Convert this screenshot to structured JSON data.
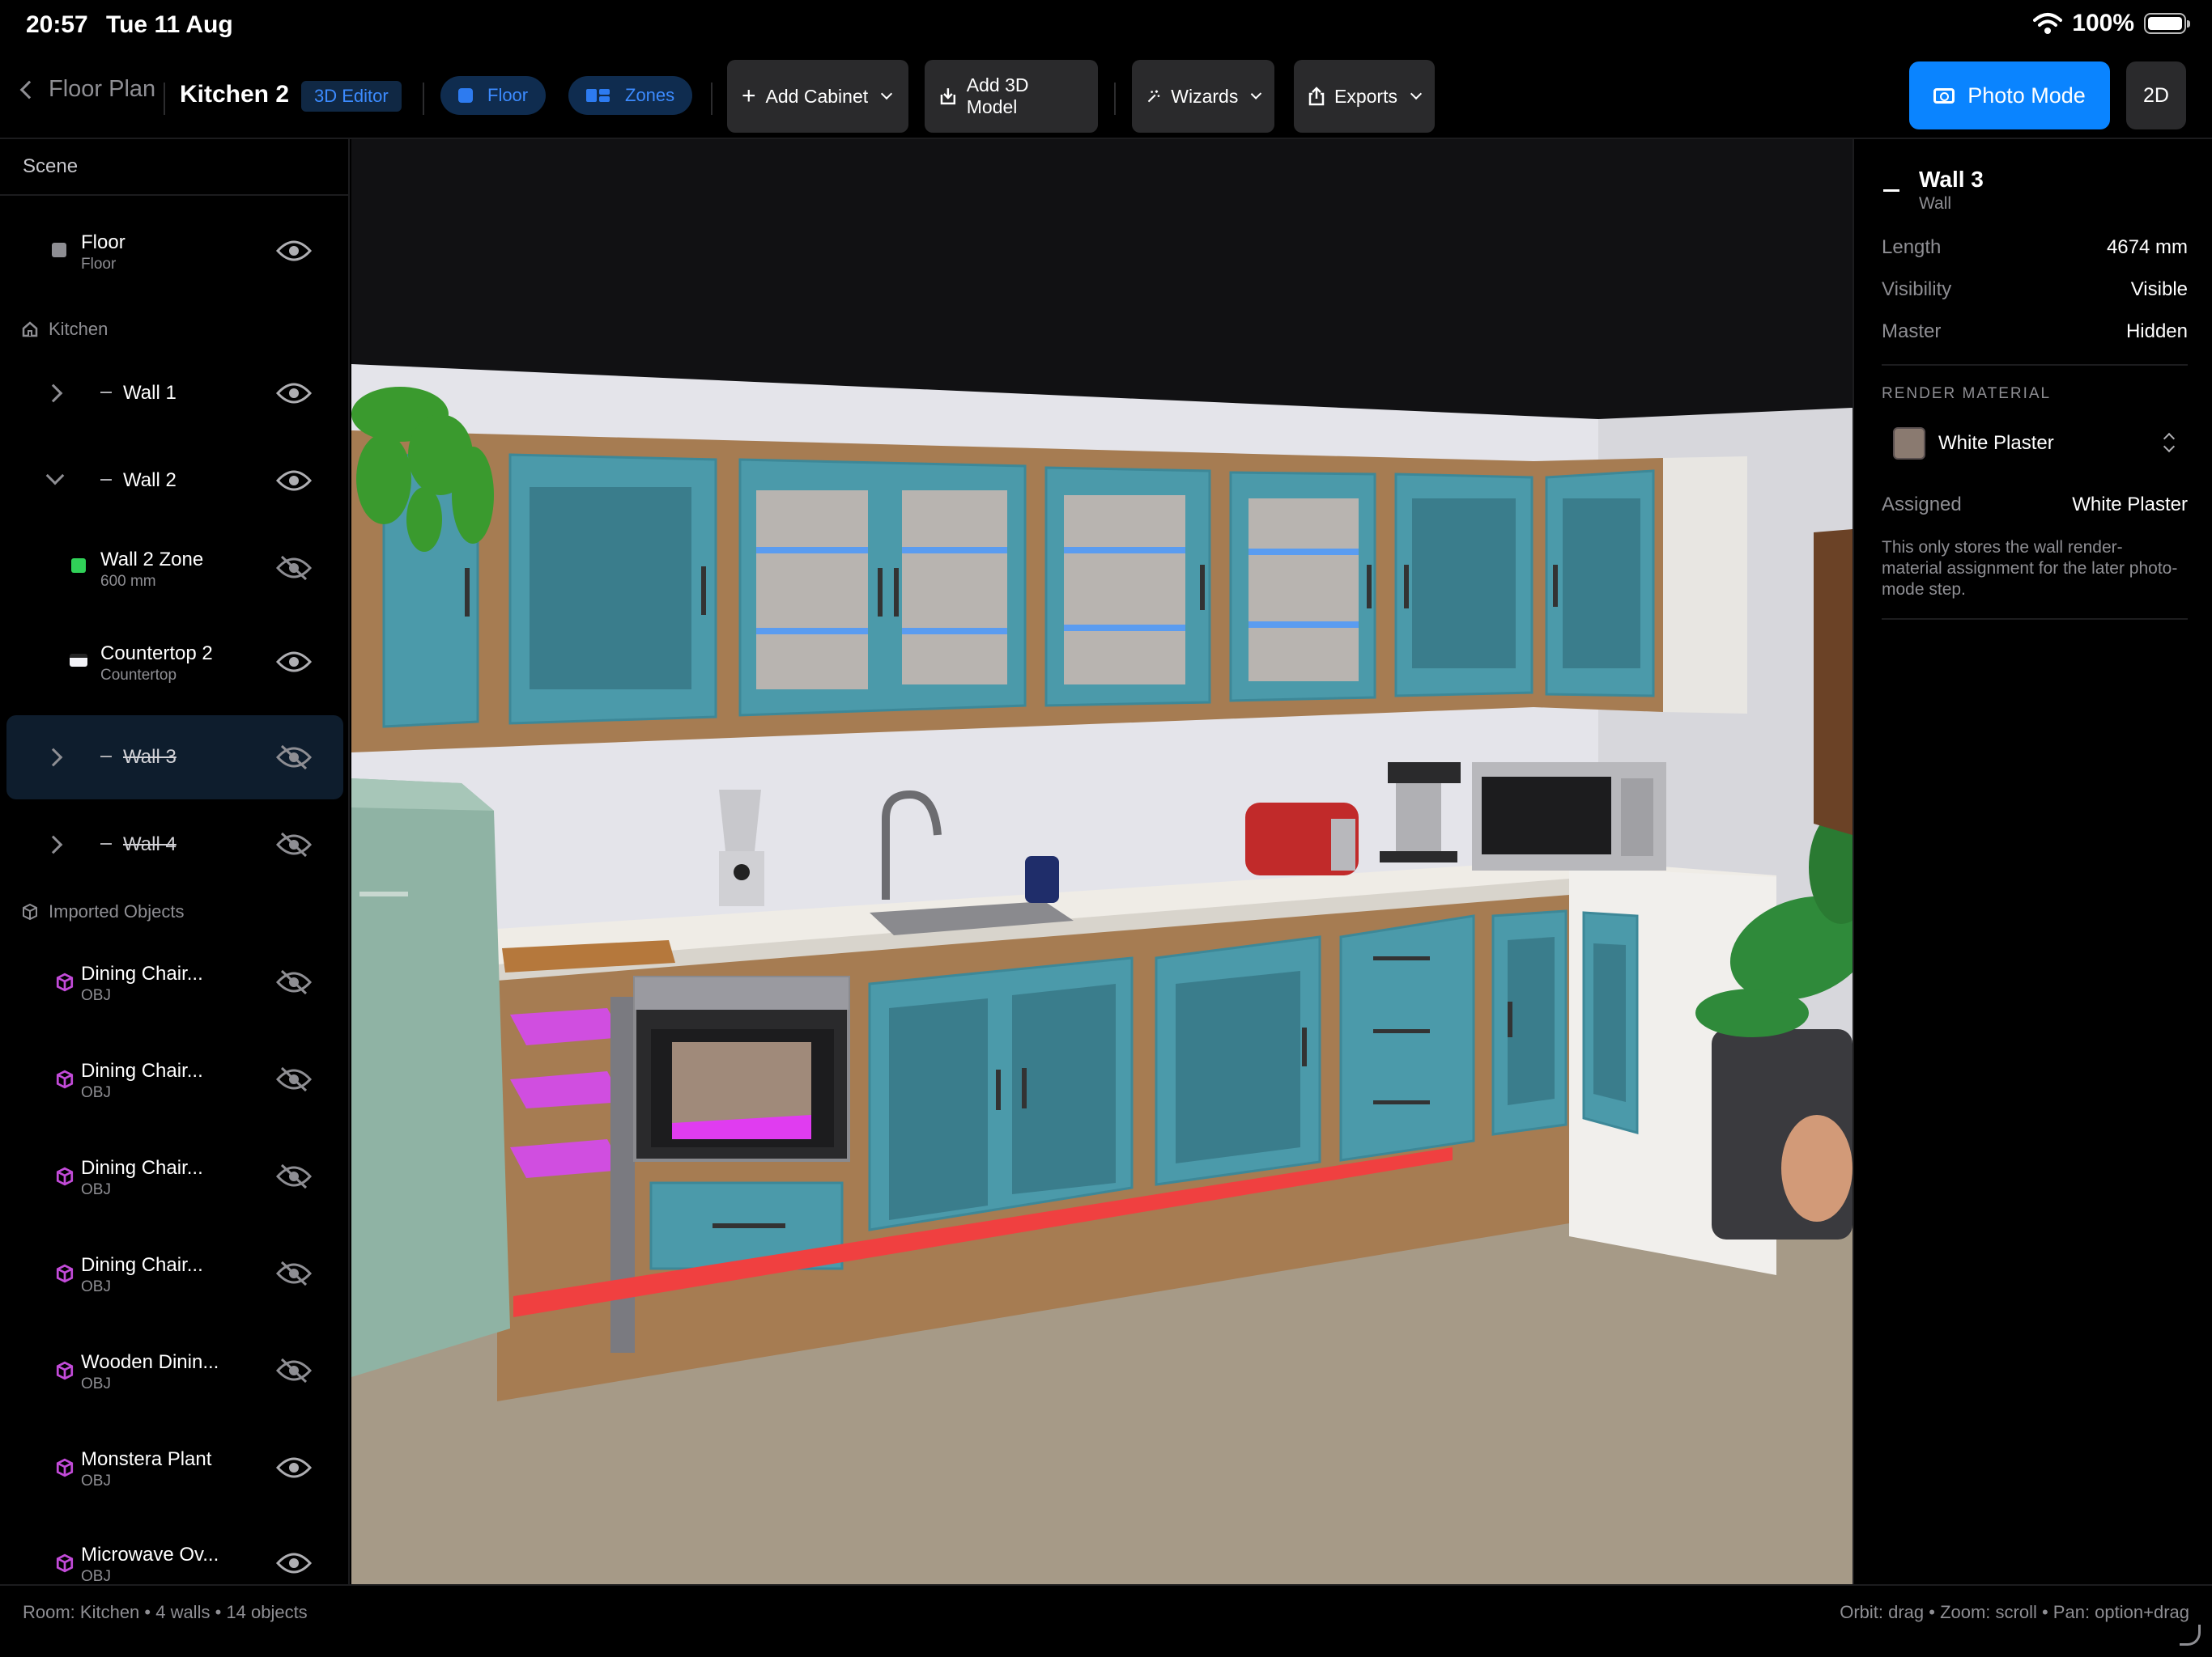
{
  "status": {
    "time": "20:57",
    "date": "Tue 11 Aug",
    "battery": "100%"
  },
  "toolbar": {
    "back_label": "Floor Plan",
    "room_title": "Kitchen 2",
    "mode_badge": "3D Editor",
    "floor_pill": "Floor",
    "zones_pill": "Zones",
    "add_cabinet": "Add Cabinet",
    "add_3d_model": "Add 3D Model",
    "wizards": "Wizards",
    "exports": "Exports",
    "photo_mode": "Photo Mode",
    "view_2d": "2D"
  },
  "scene": {
    "header": "Scene",
    "floor": {
      "title": "Floor",
      "sub": "Floor"
    },
    "kitchen_label": "Kitchen",
    "kitchen_items": [
      {
        "title": "Wall 1"
      },
      {
        "title": "Wall 2"
      },
      {
        "title": "Wall 2 Zone",
        "sub": "600 mm"
      },
      {
        "title": "Countertop 2",
        "sub": "Countertop"
      },
      {
        "title": "Wall 3"
      },
      {
        "title": "Wall 4"
      }
    ],
    "imported_label": "Imported Objects",
    "imported": [
      {
        "title": "Dining Chair...",
        "sub": "OBJ"
      },
      {
        "title": "Dining Chair...",
        "sub": "OBJ"
      },
      {
        "title": "Dining Chair...",
        "sub": "OBJ"
      },
      {
        "title": "Dining Chair...",
        "sub": "OBJ"
      },
      {
        "title": "Wooden Dinin...",
        "sub": "OBJ"
      },
      {
        "title": "Monstera Plant",
        "sub": "OBJ"
      },
      {
        "title": "Microwave Ov...",
        "sub": "OBJ"
      }
    ]
  },
  "inspector": {
    "title": "Wall 3",
    "subtitle": "Wall",
    "rows": [
      {
        "k": "Length",
        "v": "4674 mm"
      },
      {
        "k": "Visibility",
        "v": "Visible"
      },
      {
        "k": "Master",
        "v": "Hidden"
      }
    ],
    "section": "RENDER MATERIAL",
    "material": "White Plaster",
    "assigned_k": "Assigned",
    "assigned_v": "White Plaster",
    "note": "This only stores the wall render-material assignment for the later photo-mode step."
  },
  "footer": {
    "left": "Room: Kitchen  •  4 walls  •  14 objects",
    "right": "Orbit: drag  •  Zoom: scroll  •  Pan: option+drag"
  },
  "colors": {
    "accent": "#0a84ff",
    "cabinet": "#4b9aaa",
    "cabinet_frame": "#a67c52",
    "wall": "#e4e4ea",
    "floor": "#a69a87",
    "countertop": "#efece6",
    "zone_highlight": "#f04040",
    "magenta_shelf": "#e03cf0"
  }
}
